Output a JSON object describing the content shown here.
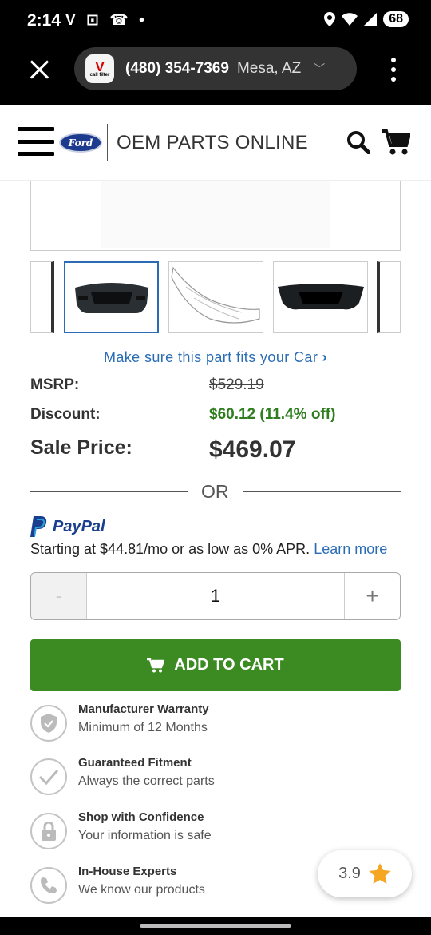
{
  "status_bar": {
    "time": "2:14",
    "notification_icons": "V ⊡ ☎ •",
    "battery": "68"
  },
  "browser": {
    "favicon_letter": "V",
    "favicon_text": "call filter",
    "phone": "(480) 354-7369",
    "city": "Mesa, AZ"
  },
  "header": {
    "brand_logo": "Ford",
    "brand_name": "OEM PARTS ONLINE"
  },
  "fitment_link": "Make sure this part fits your Car",
  "pricing": {
    "msrp_label": "MSRP:",
    "msrp_value": "$529.19",
    "discount_label": "Discount:",
    "discount_value": "$60.12 (11.4% off)",
    "sale_label": "Sale Price:",
    "sale_value": "$469.07"
  },
  "or_divider": "OR",
  "paypal": {
    "brand": "PayPal",
    "financing_text": "Starting at $44.81/mo or as low as 0% APR.",
    "learn_more": "Learn more"
  },
  "quantity": {
    "minus": "-",
    "value": "1",
    "plus": "+"
  },
  "add_to_cart_label": "ADD TO CART",
  "features": [
    {
      "icon": "shield-check-icon",
      "title": "Manufacturer Warranty",
      "desc": "Minimum of 12 Months"
    },
    {
      "icon": "checkmark-icon",
      "title": "Guaranteed Fitment",
      "desc": "Always the correct parts"
    },
    {
      "icon": "lock-icon",
      "title": "Shop with Confidence",
      "desc": "Your information is safe"
    },
    {
      "icon": "phone-icon",
      "title": "In-House Experts",
      "desc": "We know our products"
    }
  ],
  "rating": {
    "value": "3.9"
  },
  "colors": {
    "link": "#2a6db5",
    "discount": "#2e7d1e",
    "cart_button": "#3b8a22",
    "star": "#f5a623"
  }
}
